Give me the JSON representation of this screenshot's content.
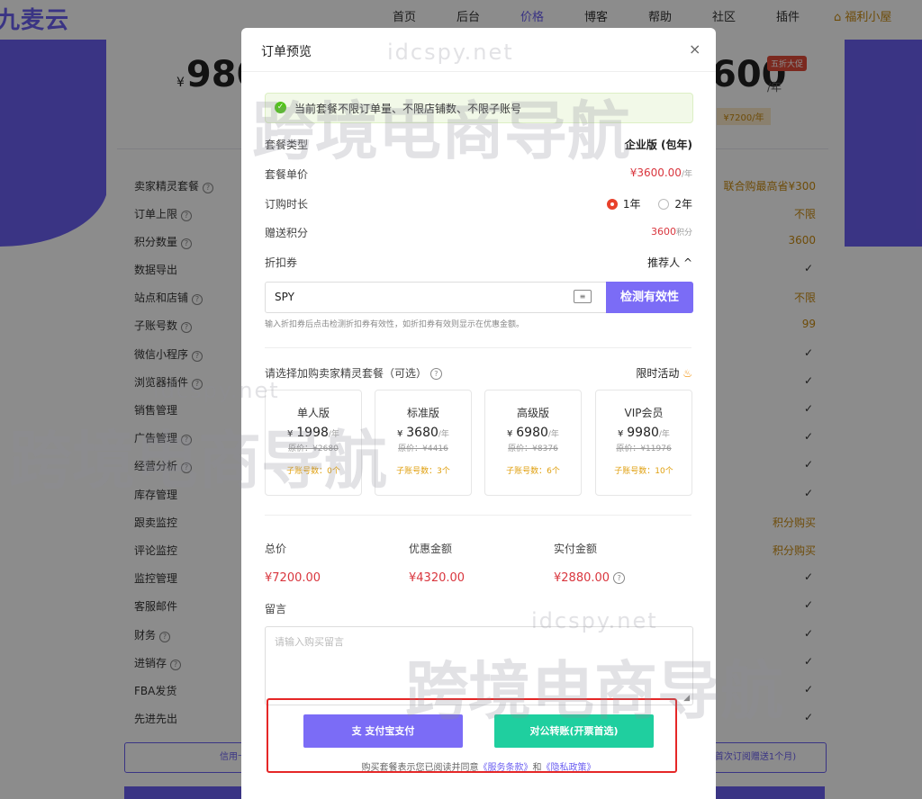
{
  "nav": {
    "logo": "九麦云",
    "items": [
      "首页",
      "后台",
      "价格",
      "博客",
      "帮助",
      "社区",
      "插件"
    ],
    "active_index": 2,
    "special_item": "福利小屋"
  },
  "background": {
    "price_left": "980",
    "price_left_yen": "¥",
    "price_right": "600",
    "per_year": "/年",
    "sale_badge": "五折大促",
    "orig_right": "¥7200/年",
    "features": [
      "卖家精灵套餐",
      "订单上限",
      "积分数量",
      "数据导出",
      "站点和店铺",
      "子账号数",
      "微信小程序",
      "浏览器插件",
      "销售管理",
      "广告管理",
      "经营分析",
      "库存管理",
      "跟卖监控",
      "评论监控",
      "监控管理",
      "客服邮件",
      "财务",
      "进销存",
      "FBA发货",
      "先进先出"
    ],
    "right_values": {
      "row0": "联合购最高省¥300",
      "row1": "不限",
      "row2": "3600",
      "row4": "不限",
      "row5": "99",
      "row12": "积分购买",
      "row13": "积分购买"
    },
    "bottom_left_btn": "信用卡订阅",
    "bottom_right_btn": "首次订阅赠送1个月)"
  },
  "modal": {
    "title": "订单预览",
    "close": "×",
    "alert": "当前套餐不限订单量、不限店铺数、不限子账号",
    "plan_type_label": "套餐类型",
    "plan_type_value": "企业版 (包年)",
    "unit_price_label": "套餐单价",
    "unit_price_value": "¥3600.00",
    "unit_price_unit": "/年",
    "duration_label": "订购时长",
    "duration_options": [
      "1年",
      "2年"
    ],
    "duration_selected": "1年",
    "points_label": "赠送积分",
    "points_value": "3600",
    "points_unit": "积分",
    "coupon_label": "折扣券",
    "referrer_label": "推荐人",
    "coupon_value": "SPY",
    "check_button": "检测有效性",
    "coupon_hint": "输入折扣券后点击检测折扣券有效性，如折扣券有效则显示在优惠金额。",
    "addon_label": "请选择加购卖家精灵套餐（可选）",
    "limited_label": "限时活动",
    "tiers": [
      {
        "name": "单人版",
        "price": "1998",
        "orig": "原价：¥2680",
        "sub": "子账号数：0个"
      },
      {
        "name": "标准版",
        "price": "3680",
        "orig": "原价：¥4416",
        "sub": "子账号数：3个"
      },
      {
        "name": "高级版",
        "price": "6980",
        "orig": "原价：¥8376",
        "sub": "子账号数：6个"
      },
      {
        "name": "VIP会员",
        "price": "9980",
        "orig": "原价：¥11976",
        "sub": "子账号数：10个"
      }
    ],
    "tier_yen": "¥",
    "tier_unit": "/年",
    "total_label": "总价",
    "total_value": "¥7200.00",
    "discount_label": "优惠金额",
    "discount_value": "¥4320.00",
    "paid_label": "实付金额",
    "paid_value": "¥2880.00",
    "note_label": "留言",
    "note_placeholder": "请输入购买留言",
    "alipay_button": "支付宝支付",
    "transfer_button": "对公转账(开票首选)",
    "terms_prefix": "购买套餐表示您已阅读并同意",
    "terms_service": "《服务条款》",
    "terms_and": "和",
    "terms_privacy": "《隐私政策》"
  },
  "watermark": {
    "domain": "idcspy.net",
    "text": "跨境电商导航"
  },
  "colors": {
    "brand": "#6b5ff1",
    "price_red": "#d9363e",
    "gold": "#c98a10",
    "transfer_green": "#1fcf9f",
    "highlight_box": "#e52727"
  }
}
